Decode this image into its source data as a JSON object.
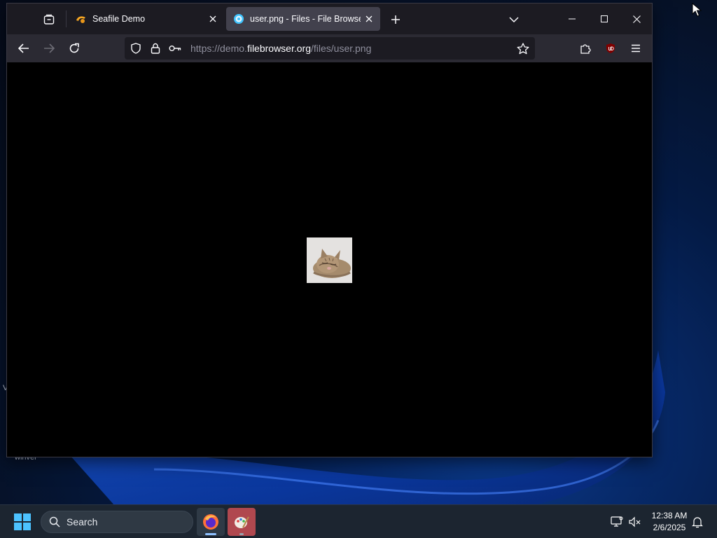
{
  "desktop": {
    "label_bottom": "winver",
    "label_left": "V"
  },
  "browser": {
    "tabs": [
      {
        "title": "Seafile Demo",
        "favicon": "seafile-favicon",
        "active": false
      },
      {
        "title": "user.png - Files - File Browser",
        "favicon": "filebrowser-favicon",
        "active": true
      }
    ],
    "url": {
      "prefix": "https://demo.",
      "domain": "filebrowser.org",
      "path": "/files/user.png"
    },
    "content": {
      "image_name": "user.png",
      "image_subject": "sleeping kitten"
    }
  },
  "taskbar": {
    "search_placeholder": "Search",
    "apps": [
      {
        "name": "Firefox",
        "icon": "firefox-icon",
        "active": true
      },
      {
        "name": "Paint",
        "icon": "paint-icon",
        "active": false
      }
    ],
    "clock": {
      "time": "12:38 AM",
      "date": "2/6/2025"
    }
  },
  "colors": {
    "toolbar": "#2b2a33",
    "titlebar": "#1c1b22",
    "active_tab": "#42414d",
    "taskbar": "#1c2530"
  }
}
